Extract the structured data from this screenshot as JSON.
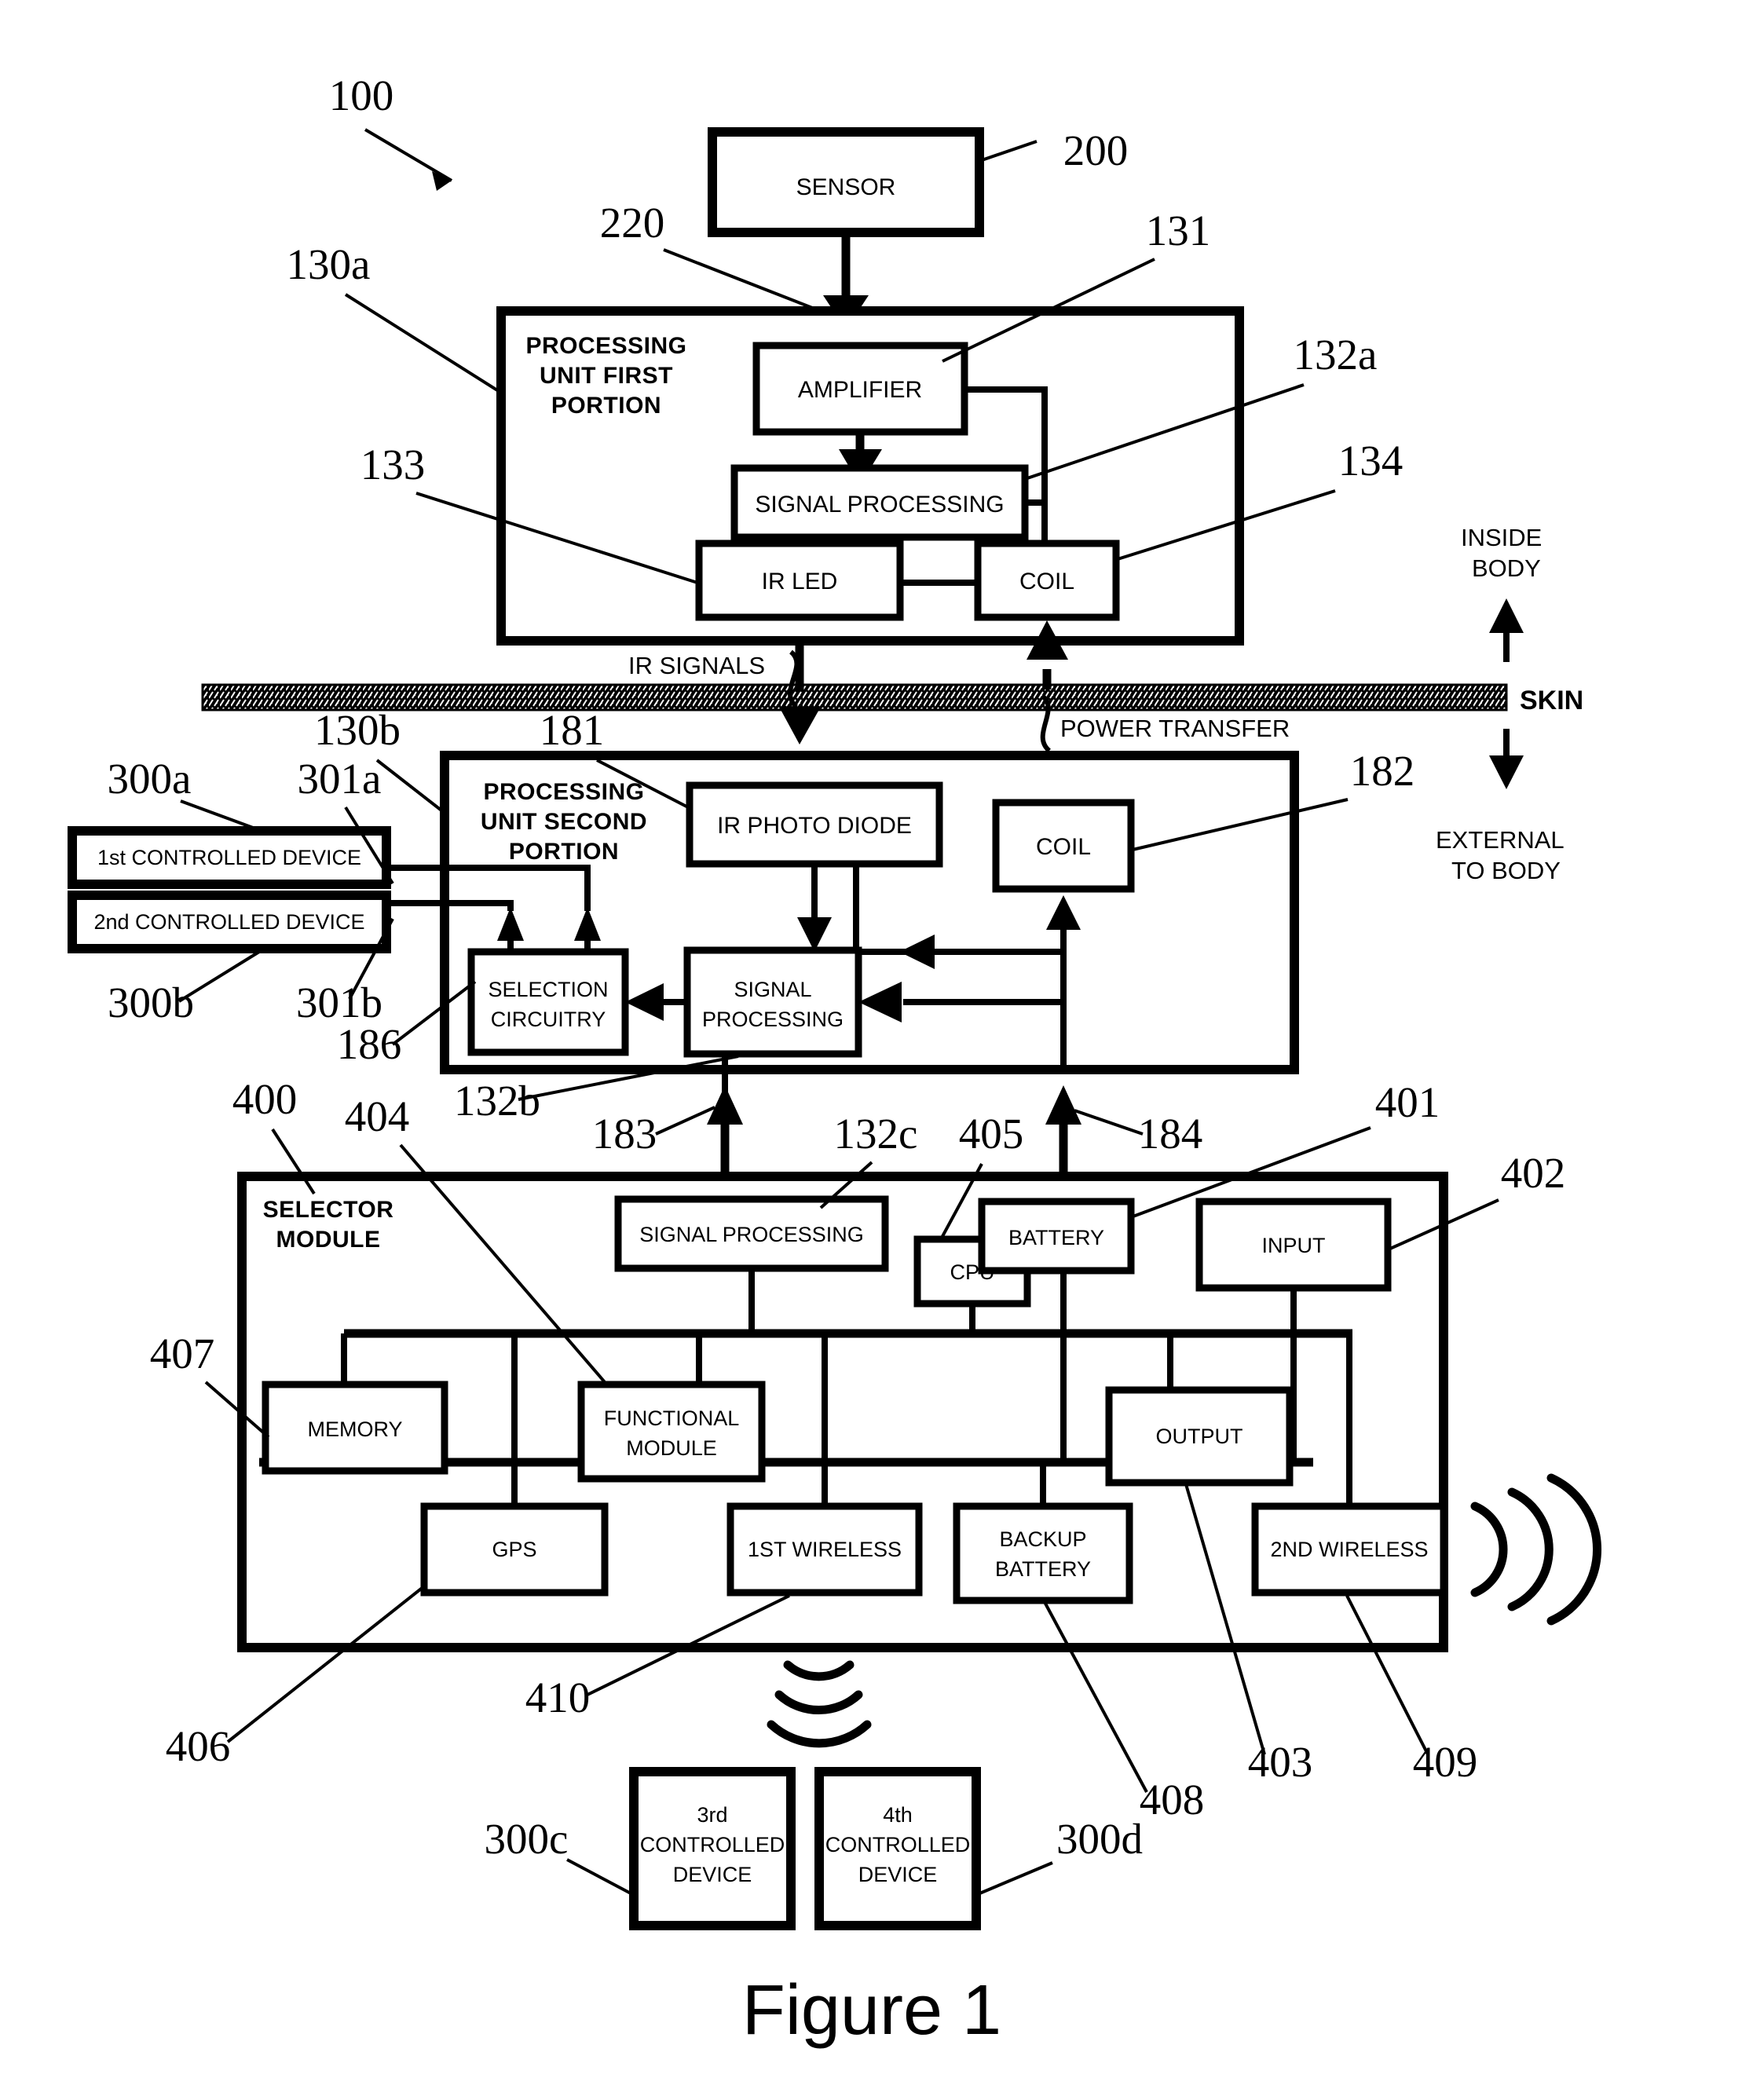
{
  "figure": {
    "caption": "Figure 1",
    "system_ref": "100"
  },
  "annotations": {
    "ir_signals": "IR SIGNALS",
    "power_transfer": "POWER TRANSFER",
    "skin": "SKIN",
    "inside_body": "INSIDE\nBODY",
    "inside_body_line1": "INSIDE",
    "inside_body_line2": "BODY",
    "external_line1": "EXTERNAL",
    "external_line2": "TO BODY"
  },
  "sensor": {
    "label": "SENSOR",
    "ref": "200",
    "link_ref": "220"
  },
  "processing_unit_first": {
    "title_line1": "PROCESSING",
    "title_line2": "UNIT FIRST",
    "title_line3": "PORTION",
    "ref": "130a",
    "blocks": [
      {
        "label": "AMPLIFIER",
        "ref": "131"
      },
      {
        "label": "SIGNAL PROCESSING",
        "ref": "132a"
      },
      {
        "label": "IR LED",
        "ref": "133"
      },
      {
        "label": "COIL",
        "ref": "134"
      }
    ]
  },
  "processing_unit_second": {
    "title_line1": "PROCESSING",
    "title_line2": "UNIT SECOND",
    "title_line3": "PORTION",
    "ref": "130b",
    "blocks": [
      {
        "label": "IR PHOTO DIODE",
        "ref": "181"
      },
      {
        "label": "COIL",
        "ref": "182"
      },
      {
        "label_line1": "SELECTION",
        "label_line2": "CIRCUITRY",
        "ref": "186"
      },
      {
        "label_line1": "SIGNAL",
        "label_line2": "PROCESSING",
        "ref": "132b"
      }
    ]
  },
  "controlled_devices": {
    "first": {
      "label": "1st CONTROLLED DEVICE",
      "ref": "300a",
      "link_ref": "301a"
    },
    "second": {
      "label": "2nd CONTROLLED DEVICE",
      "ref": "300b",
      "link_ref": "301b"
    },
    "third": {
      "label_line1": "3rd",
      "label_line2": "CONTROLLED",
      "label_line3": "DEVICE",
      "ref": "300c"
    },
    "fourth": {
      "label_line1": "4th",
      "label_line2": "CONTROLLED",
      "label_line3": "DEVICE",
      "ref": "300d"
    }
  },
  "selector_module": {
    "title_line1": "SELECTOR",
    "title_line2": "MODULE",
    "ref": "400",
    "blocks": [
      {
        "label": "SIGNAL PROCESSING",
        "ref": "132c"
      },
      {
        "label": "CPU",
        "ref": "405"
      },
      {
        "label": "BATTERY",
        "ref": "401"
      },
      {
        "label": "INPUT",
        "ref": "402"
      },
      {
        "label": "MEMORY",
        "ref": "407"
      },
      {
        "label_line1": "FUNCTIONAL",
        "label_line2": "MODULE",
        "ref": "404"
      },
      {
        "label": "GPS",
        "ref": "406"
      },
      {
        "label": "1ST WIRELESS",
        "ref": "410"
      },
      {
        "label_line1": "BACKUP",
        "label_line2": "BATTERY",
        "ref": "408"
      },
      {
        "label": "OUTPUT",
        "ref": "403"
      },
      {
        "label": "2ND WIRELESS",
        "ref": "409"
      }
    ]
  },
  "connector_refs": {
    "signal_to_selector": "183",
    "power_to_coil": "184"
  }
}
